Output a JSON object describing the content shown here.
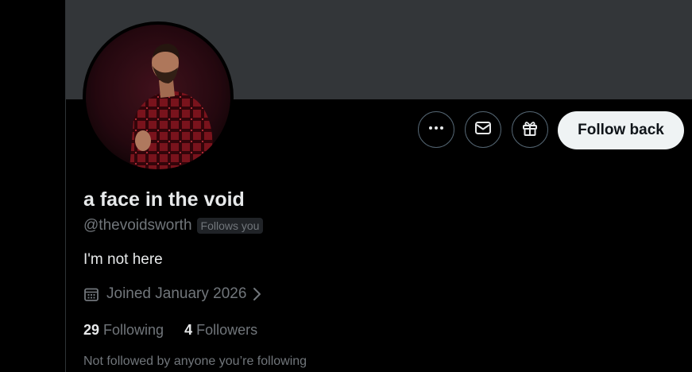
{
  "profile": {
    "display_name": "a face in the void",
    "handle": "@thevoidsworth",
    "follows_you_badge": "Follows you",
    "bio": "I'm not here",
    "joined": "Joined January 2026",
    "following_count": "29",
    "following_label": "Following",
    "followers_count": "4",
    "followers_label": "Followers",
    "not_followed_text": "Not followed by anyone you’re following"
  },
  "actions": {
    "more_icon": "more-horizontal-icon",
    "message_icon": "envelope-icon",
    "gift_icon": "gift-icon",
    "follow_back_label": "Follow back"
  },
  "colors": {
    "background": "#000000",
    "banner": "#333639",
    "text_primary": "#e7e9ea",
    "text_secondary": "#71767b",
    "button_border": "#536471",
    "follow_button_bg": "#eff3f4",
    "follow_button_text": "#0f1419"
  }
}
